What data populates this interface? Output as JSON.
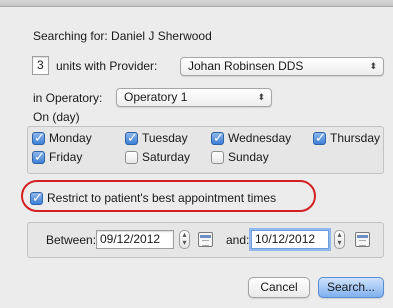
{
  "searching": {
    "text": "Searching for: Daniel J Sherwood"
  },
  "units": {
    "value": "3",
    "label": "units with Provider:"
  },
  "provider": {
    "selected": "Johan  Robinsen DDS"
  },
  "operatory": {
    "label": "in Operatory:",
    "selected": "Operatory 1"
  },
  "days": {
    "heading": "On (day)",
    "items": [
      {
        "label": "Monday",
        "checked": true
      },
      {
        "label": "Tuesday",
        "checked": true
      },
      {
        "label": "Wednesday",
        "checked": true
      },
      {
        "label": "Thursday",
        "checked": true
      },
      {
        "label": "Friday",
        "checked": true
      },
      {
        "label": "Saturday",
        "checked": false
      },
      {
        "label": "Sunday",
        "checked": false
      }
    ]
  },
  "restrict": {
    "label": "Restrict to patient's best appointment times",
    "checked": true
  },
  "between": {
    "label": "Between:",
    "start": "09/12/2012",
    "and_label": "and:",
    "end": "10/12/2012"
  },
  "buttons": {
    "cancel": "Cancel",
    "search": "Search..."
  },
  "colors": {
    "highlight_oval": "#d42020",
    "default_button": "#7fb0ef"
  }
}
